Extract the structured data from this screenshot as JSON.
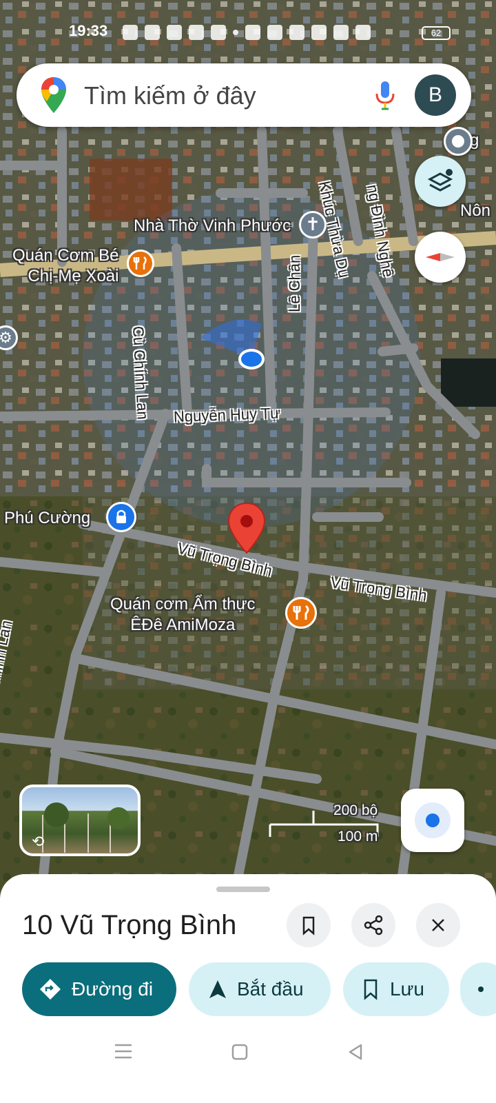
{
  "status_bar": {
    "time": "19:33",
    "battery": "62",
    "icons": [
      "zalo-icon",
      "person-add-icon",
      "messenger-icon",
      "app-icon",
      "app-icon",
      "dot-icon",
      "mute-icon",
      "location-icon",
      "wifi-icon",
      "volte-icon",
      "signal-icon",
      "signal-icon",
      "battery-icon"
    ]
  },
  "search": {
    "placeholder": "Tìm kiếm ở đây",
    "avatar_letter": "B"
  },
  "map": {
    "places": {
      "church": "Nhà Thờ Vinh Phước",
      "restaurant1": "Quán Cơm Bé\nChị-Mẹ Xoài",
      "phu_cuong": "Phú Cường",
      "restaurant2": "Quán cơm Ẩm thực\nÊĐê AmiMoza",
      "nong_partial": "Nôn",
      "g_partial": "g"
    },
    "roads": {
      "cu_chinh_lan": "Cù Chính Lan",
      "le_chan": "Lê Chân",
      "nguyen_huy_tu": "Nguyễn Huy Tự",
      "vu_trong_binh": "Vũ Trọng Bình",
      "khuc_thua_du": "Khúc Thừa Dụ",
      "dinh_nghe": "ng Đình Nghệ"
    },
    "scale": {
      "feet": "200 bộ",
      "meters": "100 m"
    }
  },
  "colors": {
    "accent": "#0b6e7c",
    "chip_bg": "#d6f1f5",
    "pin": "#ea4335",
    "poi_orange": "#e8710a",
    "poi_blue": "#1a73e8",
    "location_dot": "#1a73e8"
  },
  "place": {
    "title": "10 Vũ Trọng Bình"
  },
  "actions": {
    "directions": "Đường đi",
    "start": "Bắt đầu",
    "save": "Lưu"
  }
}
